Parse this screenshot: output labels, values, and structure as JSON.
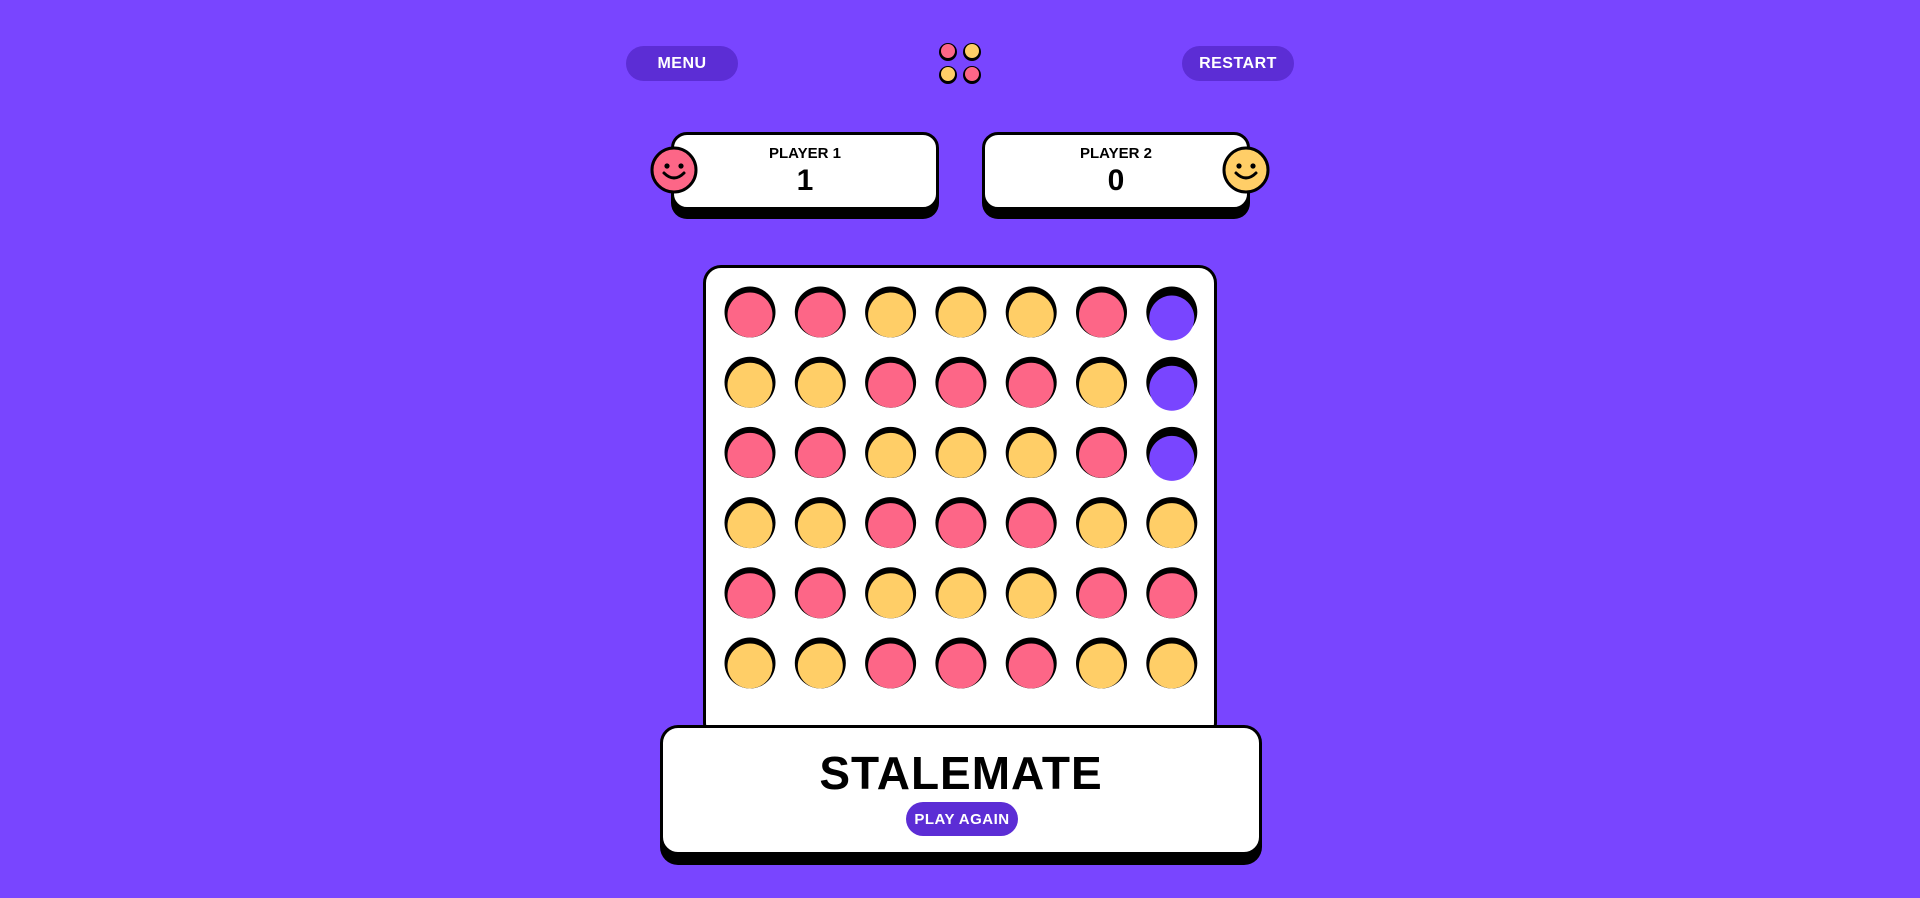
{
  "header": {
    "menu_label": "MENU",
    "restart_label": "RESTART",
    "logo_icon": "four-discs-logo-icon"
  },
  "players": [
    {
      "label": "PLAYER 1",
      "score": "1",
      "color": "#FD6687",
      "icon": "smiley-face-icon"
    },
    {
      "label": "PLAYER 2",
      "score": "0",
      "color": "#FFCE67",
      "icon": "smiley-face-icon"
    }
  ],
  "colors": {
    "background": "#7945FF",
    "button": "#5C2DD5",
    "red": "#FD6687",
    "yellow": "#FFCE67",
    "empty": "#7945FF"
  },
  "board": {
    "columns": 7,
    "rows": 6,
    "cells": [
      [
        "R",
        "R",
        "Y",
        "Y",
        "Y",
        "R",
        "E"
      ],
      [
        "Y",
        "Y",
        "R",
        "R",
        "R",
        "Y",
        "E"
      ],
      [
        "R",
        "R",
        "Y",
        "Y",
        "Y",
        "R",
        "E"
      ],
      [
        "Y",
        "Y",
        "R",
        "R",
        "R",
        "Y",
        "Y"
      ],
      [
        "R",
        "R",
        "Y",
        "Y",
        "Y",
        "R",
        "R"
      ],
      [
        "Y",
        "Y",
        "R",
        "R",
        "R",
        "Y",
        "Y"
      ]
    ]
  },
  "result": {
    "title": "STALEMATE",
    "play_again_label": "PLAY AGAIN"
  }
}
